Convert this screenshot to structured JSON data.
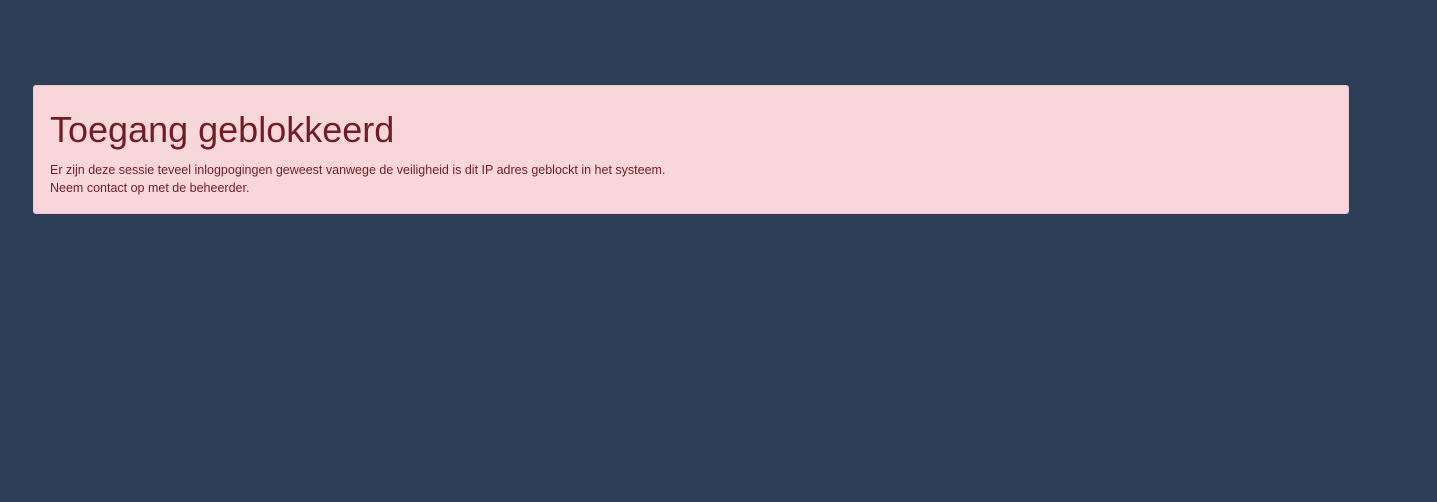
{
  "alert": {
    "title": "Toegang geblokkeerd",
    "line1": "Er zijn deze sessie teveel inlogpogingen geweest vanwege de veiligheid is dit IP adres geblockt in het systeem.",
    "line2": "Neem contact op met de beheerder."
  },
  "colors": {
    "background": "#2b3f56",
    "alert_background": "#f8d7da",
    "alert_text": "#721c24"
  }
}
